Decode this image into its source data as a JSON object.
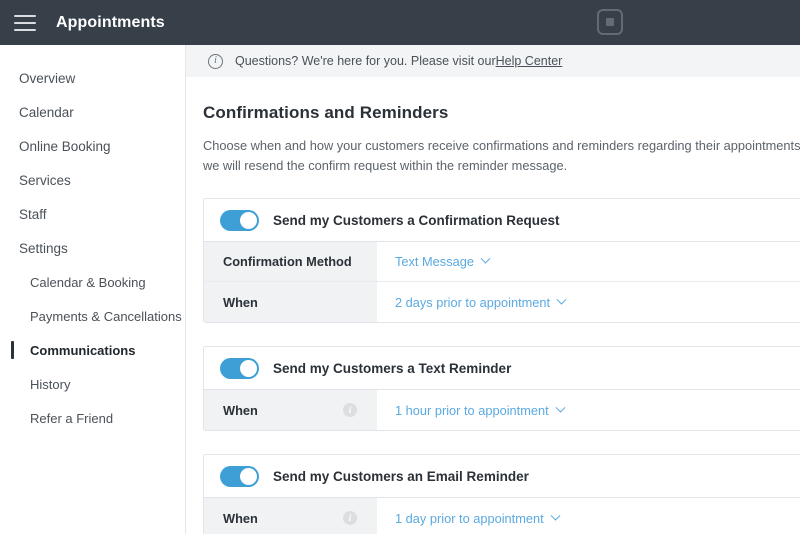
{
  "header": {
    "title": "Appointments",
    "menu_icon": "hamburger-icon",
    "logo_icon": "square-logo-icon"
  },
  "sidebar": {
    "items": [
      {
        "label": "Overview",
        "active": false,
        "sub": false
      },
      {
        "label": "Calendar",
        "active": false,
        "sub": false
      },
      {
        "label": "Online Booking",
        "active": false,
        "sub": false
      },
      {
        "label": "Services",
        "active": false,
        "sub": false
      },
      {
        "label": "Staff",
        "active": false,
        "sub": false
      },
      {
        "label": "Settings",
        "active": false,
        "sub": false
      },
      {
        "label": "Calendar & Booking",
        "active": false,
        "sub": true
      },
      {
        "label": "Payments & Cancellations",
        "active": false,
        "sub": true
      },
      {
        "label": "Communications",
        "active": true,
        "sub": true
      },
      {
        "label": "History",
        "active": false,
        "sub": true
      },
      {
        "label": "Refer a Friend",
        "active": false,
        "sub": true
      }
    ]
  },
  "banner": {
    "icon": "info-circle-icon",
    "text": "Questions? We're here for you. Please visit our ",
    "link_label": "Help Center"
  },
  "main": {
    "title": "Confirmations and Reminders",
    "description": "Choose when and how your customers receive confirmations and reminders regarding their appointments.\nwe will resend the confirm request within the reminder message."
  },
  "cards": [
    {
      "toggle_label": "Send my Customers a Confirmation Request",
      "toggle_on": true,
      "rows": [
        {
          "label": "Confirmation Method",
          "value": "Text Message",
          "has_info": false
        },
        {
          "label": "When",
          "value": "2 days prior to appointment",
          "has_info": false
        }
      ]
    },
    {
      "toggle_label": "Send my Customers a Text Reminder",
      "toggle_on": true,
      "rows": [
        {
          "label": "When",
          "value": "1 hour prior to appointment",
          "has_info": true
        }
      ]
    },
    {
      "toggle_label": "Send my Customers an Email Reminder",
      "toggle_on": true,
      "rows": [
        {
          "label": "When",
          "value": "1 day prior to appointment",
          "has_info": true
        }
      ]
    }
  ],
  "colors": {
    "header_bg": "#373f49",
    "toggle_on": "#3e9fd6",
    "link_blue": "#5aa9e0",
    "row_label_bg": "#f0f2f3",
    "banner_bg": "#f2f4f5"
  },
  "glyphs": {
    "info": "i",
    "chevron_down": "chevron-down-icon"
  }
}
